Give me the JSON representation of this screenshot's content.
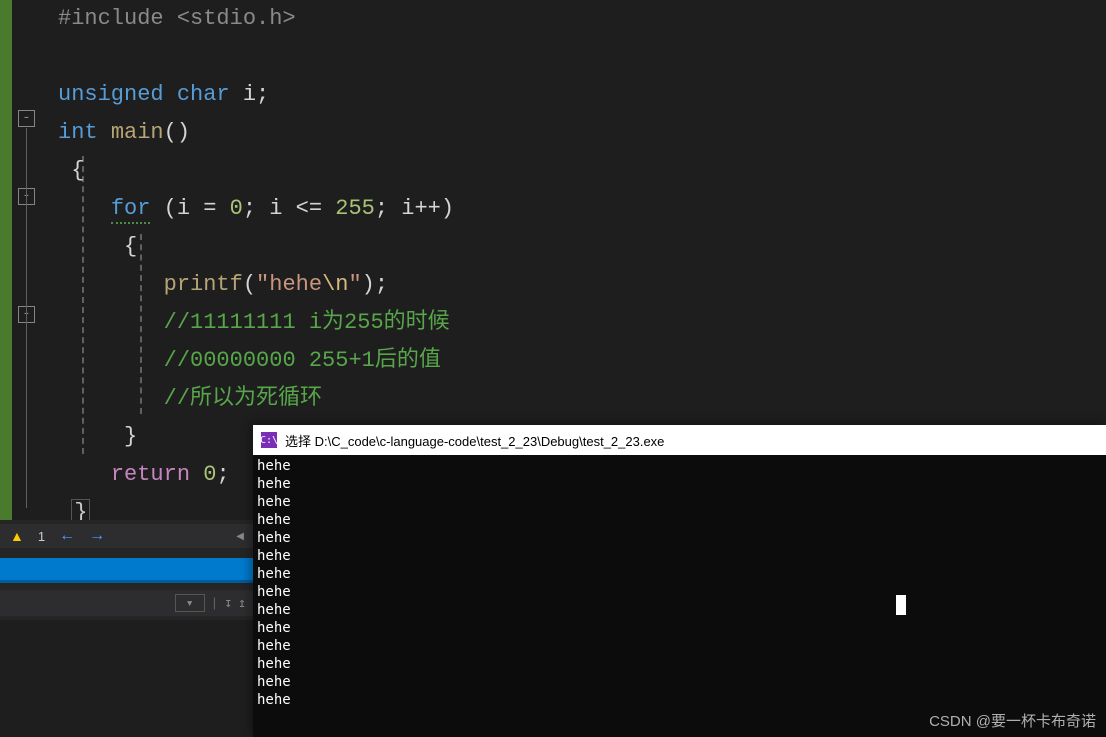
{
  "code": {
    "line_include": "#include <stdio.h>",
    "line_decl_kw": "unsigned char",
    "line_decl_name": "i",
    "line_decl_sc": ";",
    "line_main_kw": "int",
    "line_main_fn": "main",
    "line_main_paren": "()",
    "line_obrace": "{",
    "line_for_kw": "for",
    "line_for_lp": " (",
    "line_for_i1": "i ",
    "line_for_eq": "= ",
    "line_for_zero": "0",
    "line_for_sep1": "; ",
    "line_for_i2": "i ",
    "line_for_lte": "<= ",
    "line_for_255": "255",
    "line_for_sep2": "; ",
    "line_for_inc": "i++)",
    "line_for_obrace": "{",
    "line_printf_fn": "printf",
    "line_printf_lp": "(",
    "line_printf_q1": "\"",
    "line_printf_txt": "hehe",
    "line_printf_esc": "\\n",
    "line_printf_q2": "\"",
    "line_printf_rp": ");",
    "line_c1": "//11111111 i为255的时候",
    "line_c2": "//00000000 255+1后的值",
    "line_c3": "//所以为死循环",
    "line_for_cbrace": "}",
    "line_ret_kw": "return",
    "line_ret_val": "0",
    "line_ret_sc": ";",
    "line_cbrace": "}"
  },
  "gutter": {
    "minus": "-"
  },
  "errbar": {
    "warn": "▲",
    "warn_count": "1",
    "left_arrow": "←",
    "right_arrow": "→"
  },
  "toolbar": {
    "drop": " ",
    "chev": "▾",
    "sep": "|",
    "ic1": "↧",
    "ic2": "↥"
  },
  "console": {
    "icon_label": "C:\\",
    "title": "选择 D:\\C_code\\c-language-code\\test_2_23\\Debug\\test_2_23.exe",
    "lines": [
      "hehe",
      "hehe",
      "hehe",
      "hehe",
      "hehe",
      "hehe",
      "hehe",
      "hehe",
      "hehe",
      "hehe",
      "hehe",
      "hehe",
      "hehe",
      "hehe"
    ]
  },
  "watermark": "CSDN @要一杯卡布奇诺"
}
